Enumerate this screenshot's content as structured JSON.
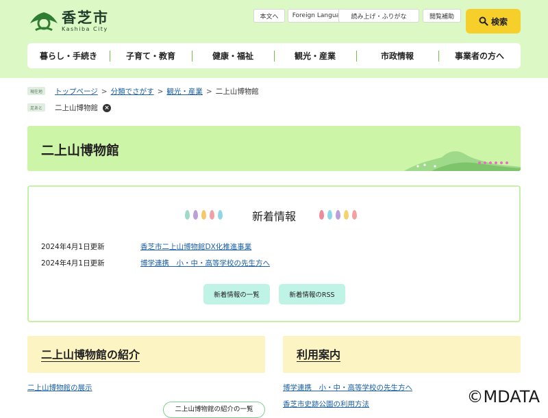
{
  "header": {
    "logo_name": "香芝市",
    "logo_roman": "Kashiba City",
    "utility_links": [
      "本文へ",
      "Foreign Language",
      "読み上げ・ふりがな",
      "閲覧補助"
    ],
    "search_label": "検索"
  },
  "nav": {
    "items": [
      "暮らし・手続き",
      "子育て・教育",
      "健康・福祉",
      "観光・産業",
      "市政情報",
      "事業者の方へ"
    ]
  },
  "breadcrumb": {
    "current_tag": "現在地",
    "items": [
      "トップページ",
      "分類でさがす",
      "観光・産業"
    ],
    "current": "二上山博物館",
    "trail_tag": "足あと",
    "trail_item": "二上山博物館"
  },
  "page": {
    "title": "二上山博物館"
  },
  "news": {
    "title": "新着情報",
    "items": [
      {
        "date": "2024年4月1日更新",
        "link": "香芝市二上山博物館DX化推進事業"
      },
      {
        "date": "2024年4月1日更新",
        "link": "博学連携　小・中・高等学校の先生方へ"
      }
    ],
    "list_button": "新着情報の一覧",
    "rss_button": "新着情報のRSS"
  },
  "sections": {
    "intro": {
      "title": "二上山博物館の紹介",
      "links": [
        "二上山博物館の展示"
      ],
      "more_button": "二上山博物館の紹介の一覧"
    },
    "guide": {
      "title": "利用案内",
      "links": [
        "博学連携　小・中・高等学校の先生方へ",
        "香芝市史跡公園の利用方法"
      ]
    }
  },
  "watermark": "©MDATA",
  "colors": {
    "header_bg": "#dcf8c4",
    "title_bg": "#ccf5a7",
    "news_border": "#c6f1a4",
    "section_bg": "#fdf4c4",
    "pill_bg": "#bff3e6",
    "search_bg": "#f7cf2b",
    "link": "#1a5fa8"
  },
  "icons": [
    "city-emblem-icon",
    "magnifier-icon",
    "close-circle-icon",
    "leaf-icon",
    "hills-illustration"
  ]
}
